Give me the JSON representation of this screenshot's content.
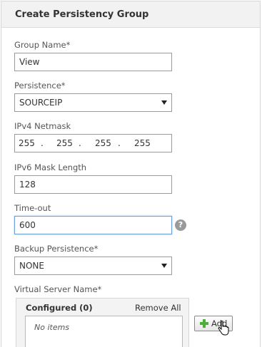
{
  "dialog": {
    "title": "Create Persistency Group"
  },
  "group_name": {
    "label": "Group Name*",
    "value": "View"
  },
  "persistence": {
    "label": "Persistence*",
    "value": "SOURCEIP"
  },
  "ipv4_netmask": {
    "label": "IPv4 Netmask",
    "octets": [
      "255",
      "255",
      "255",
      "255"
    ],
    "separator": "."
  },
  "ipv6_mask_length": {
    "label": "IPv6 Mask Length",
    "value": "128"
  },
  "timeout": {
    "label": "Time-out",
    "value": "600",
    "help_glyph": "?"
  },
  "backup_persistence": {
    "label": "Backup Persistence*",
    "value": "NONE"
  },
  "virtual_server": {
    "label": "Virtual Server Name*",
    "configured_label": "Configured (0)",
    "remove_all_label": "Remove All",
    "empty_text": "No items",
    "add_label": "Add"
  },
  "icons": {
    "help": "help-icon",
    "dropdown": "chevron-down-icon",
    "add": "plus-icon",
    "cursor": "hand-cursor-icon"
  },
  "colors": {
    "header_bg": "#f2f2f2",
    "focus_border": "#6da0d8",
    "add_icon": "#4caf3a"
  }
}
